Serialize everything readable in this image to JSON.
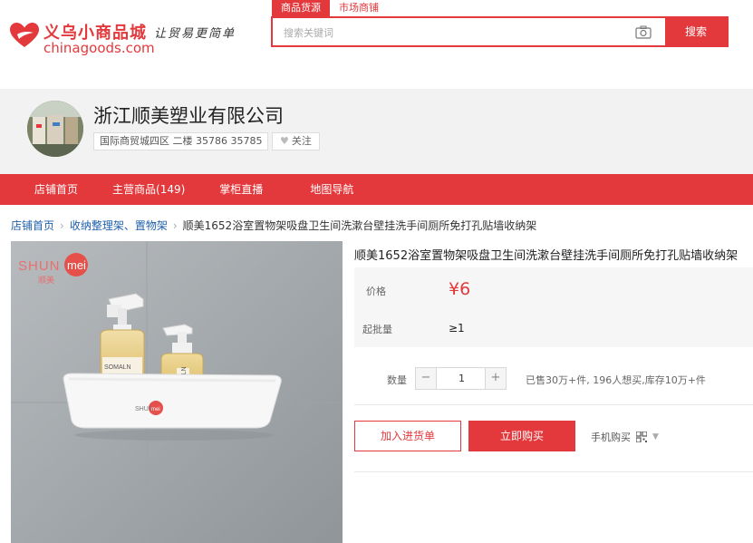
{
  "header": {
    "logo_cn": "义乌小商品城",
    "logo_en": "chinagoods.com",
    "slogan": "让贸易更简单",
    "search_tabs": [
      {
        "label": "商品货源",
        "active": true
      },
      {
        "label": "市场商铺",
        "active": false
      }
    ],
    "search_placeholder": "搜索关键词",
    "search_button": "搜索"
  },
  "shop": {
    "name": "浙江顺美塑业有限公司",
    "address": "国际商贸城四区 二楼 35786 35785",
    "follow_label": "关注"
  },
  "nav": {
    "items": [
      {
        "label": "店铺首页"
      },
      {
        "label": "主营商品(149)"
      },
      {
        "label": "掌柜直播"
      },
      {
        "label": "地图导航"
      }
    ]
  },
  "breadcrumb": {
    "home": "店铺首页",
    "category": "收纳整理架、置物架",
    "current": "顺美1652浴室置物架吸盘卫生间洗漱台壁挂洗手间厕所免打孔贴墙收纳架"
  },
  "product": {
    "title": "顺美1652浴室置物架吸盘卫生间洗漱台壁挂洗手间厕所免打孔贴墙收纳架",
    "price_label": "价格",
    "price": "¥6",
    "moq_label": "起批量",
    "moq": "≥1",
    "qty_label": "数量",
    "qty_value": "1",
    "qty_minus": "−",
    "qty_plus": "+",
    "stock_info": "已售30万+件, 196人想买,库存10万+件",
    "add_to_list": "加入进货单",
    "buy_now": "立即购买",
    "mobile_buy": "手机购买",
    "image_brand_latin": "SHUNmei",
    "image_brand_cn": "顺美",
    "bottle_label_1": "SOMALN",
    "bottle_label_2": "SOMALN"
  },
  "colors": {
    "brand_red": "#e4393c",
    "link_blue": "#1f5faa"
  },
  "icons": [
    "heart-logo-icon",
    "camera-icon",
    "heart-icon",
    "qr-code-icon",
    "chevron-down-icon",
    "chevron-right-icon"
  ]
}
